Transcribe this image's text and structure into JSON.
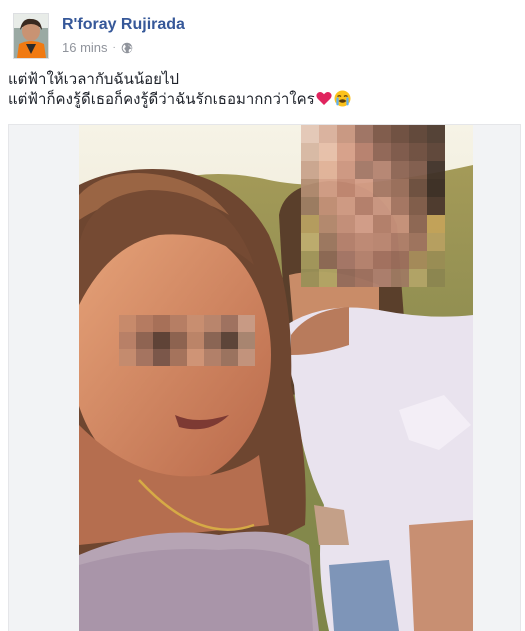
{
  "post": {
    "author_name": "R'foray Rujirada",
    "timestamp": "16 mins",
    "privacy_icon": "globe-icon",
    "text_lines": [
      "แต่ฟ้าให้เวลากับฉันน้อยไป",
      "แต่ฟ้าก็คงรู้ดีเธอก็คงรู้ดีว่าฉันรักเธอมากกว่าใคร"
    ],
    "emojis": [
      "heart-emoji",
      "crying-face-emoji"
    ]
  },
  "colors": {
    "author_link": "#365899",
    "meta_gray": "#90949c",
    "text": "#1d2129",
    "heart": "#e0245e"
  }
}
